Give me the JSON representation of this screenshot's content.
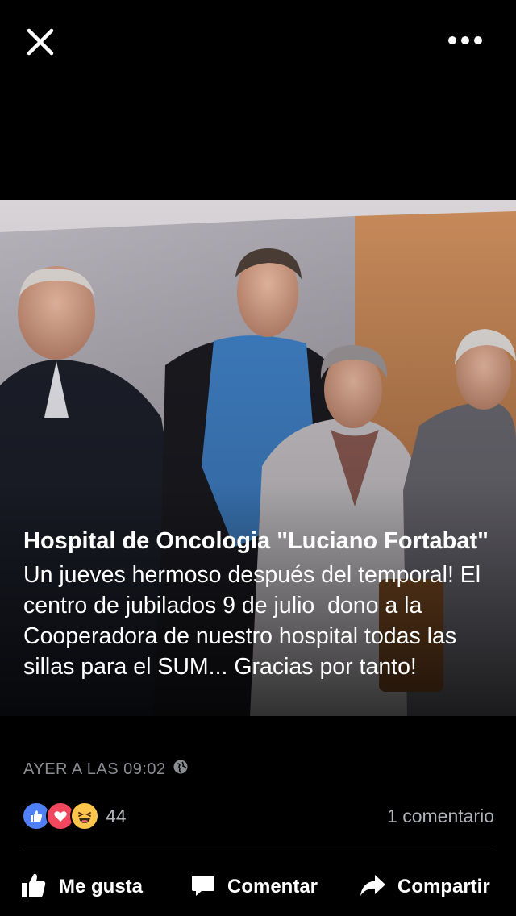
{
  "post": {
    "page_name": "Hospital de Oncologia \"Luciano Fortabat\"",
    "caption": "Un jueves hermoso después del temporal! El centro de jubilados 9 de julio  dono a la Cooperadora de nuestro hospital todas las sillas para el SUM... Gracias por tanto!",
    "timestamp": "AYER A LAS 09:02",
    "timestamp_icon": "globe-icon"
  },
  "reactions": {
    "types": [
      "like",
      "love",
      "haha"
    ],
    "count": "44",
    "comments_label": "1 comentario"
  },
  "actions": {
    "like_label": "Me gusta",
    "comment_label": "Comentar",
    "share_label": "Compartir"
  },
  "colors": {
    "like_blue": "#4f80f7",
    "love_red": "#f2475c",
    "haha_yellow": "#fdc54b",
    "meta_gray": "#8a8d91"
  }
}
